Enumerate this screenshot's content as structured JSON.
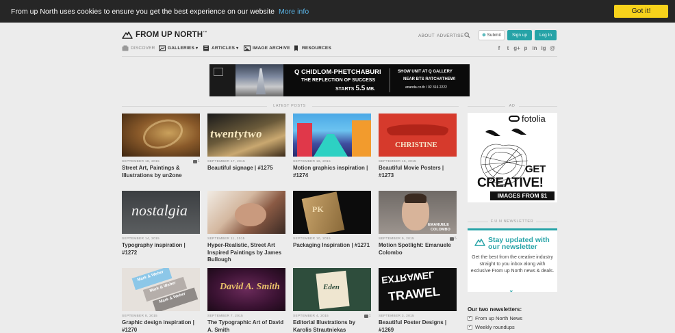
{
  "cookie": {
    "message": "From up North uses cookies to ensure you get the best experience on our website",
    "more_info": "More info",
    "accept": "Got it!"
  },
  "header": {
    "logo": "FROM UP NORTH",
    "logo_mark": "™",
    "links": [
      "ABOUT",
      "ADVERTISE"
    ],
    "submit": "Submit",
    "signup": "Sign up",
    "login": "Log In"
  },
  "nav": {
    "items": [
      "DISCOVER",
      "GALLERIES",
      "ARTICLES",
      "IMAGE ARCHIVE",
      "RESOURCES"
    ]
  },
  "social": [
    "f",
    "t",
    "g+",
    "p",
    "in",
    "ig",
    "@"
  ],
  "banner": {
    "headline": "Q CHIDLOM-PHETCHABURI",
    "line2": "THE REFLECTION OF SUCCESS",
    "line3_prefix": "STARTS",
    "price": "5.5",
    "unit": "MB.",
    "right1": "SHOW UNIT AT Q GALLERY",
    "right2": "NEAR BTS RATCHATHEWI",
    "right3": "ananda.co.th / 02 316 2222"
  },
  "latest_label": "LATEST POSTS",
  "ad_label": "AD",
  "newsletter_label": "F.U.N NEWSLETTER",
  "posts": [
    {
      "date": "SEPTEMBER 18, 2015",
      "comments": "1",
      "title": "Street Art, Paintings & Illustrations by un2one"
    },
    {
      "date": "SEPTEMBER 17, 2015",
      "comments": "",
      "title": "Beautiful signage | #1275"
    },
    {
      "date": "SEPTEMBER 16, 2015",
      "comments": "",
      "title": "Motion graphics inspiration | #1274"
    },
    {
      "date": "SEPTEMBER 15, 2015",
      "comments": "",
      "title": "Beautiful Movie Posters | #1273"
    },
    {
      "date": "SEPTEMBER 14, 2015",
      "comments": "",
      "title": "Typography inspiration | #1272"
    },
    {
      "date": "SEPTEMBER 11, 2015",
      "comments": "",
      "title": "Hyper-Realistic, Street Art Inspired Paintings by James Bullough"
    },
    {
      "date": "SEPTEMBER 10, 2015",
      "comments": "",
      "title": "Packaging Inspiration | #1271"
    },
    {
      "date": "SEPTEMBER 9, 2015",
      "comments": "6",
      "title": "Motion Spotlight: Emanuele Colombo"
    },
    {
      "date": "SEPTEMBER 8, 2015",
      "comments": "",
      "title": "Graphic design inspiration | #1270"
    },
    {
      "date": "SEPTEMBER 7, 2015",
      "comments": "",
      "title": "The Typographic Art of David A. Smith"
    },
    {
      "date": "SEPTEMBER 4, 2015",
      "comments": "1",
      "title": "Editorial Illustrations by Karolis Strautniekas"
    },
    {
      "date": "SEPTEMBER 3, 2015",
      "comments": "",
      "title": "Beautiful Poster Designs | #1269"
    }
  ],
  "thumb_text": {
    "t2": "twentytwo",
    "t4": "CHRISTINE",
    "t5": "nostalgia",
    "t7": "PK",
    "t8a": "EMANUELE",
    "t8b": "COLOMBO",
    "t9a": "Mark & Weber",
    "t9b": "Mark & Weber",
    "t9c": "Mark & Weber",
    "t10": "David A. Smith",
    "t11": "Eden",
    "t12a": "EXTRAWEL",
    "t12b": "TRAWEL"
  },
  "ad": {
    "brand": "fotolia",
    "get": "GET",
    "creative": "CREATIVE!",
    "images": "IMAGES FROM $1"
  },
  "newsletter": {
    "title": "Stay updated with our newsletter",
    "body": "Get the best from the creative industry straight to you inbox along with exclusive From up North news & deals.",
    "our_two": "Our two newsletters:",
    "options": [
      "From up North News",
      "Weekly roundups"
    ]
  },
  "colors": {
    "accent": "#26a3a7",
    "cookie_button": "#f7d21b",
    "cookie_bar": "#262626",
    "link": "#5ab4e6"
  }
}
